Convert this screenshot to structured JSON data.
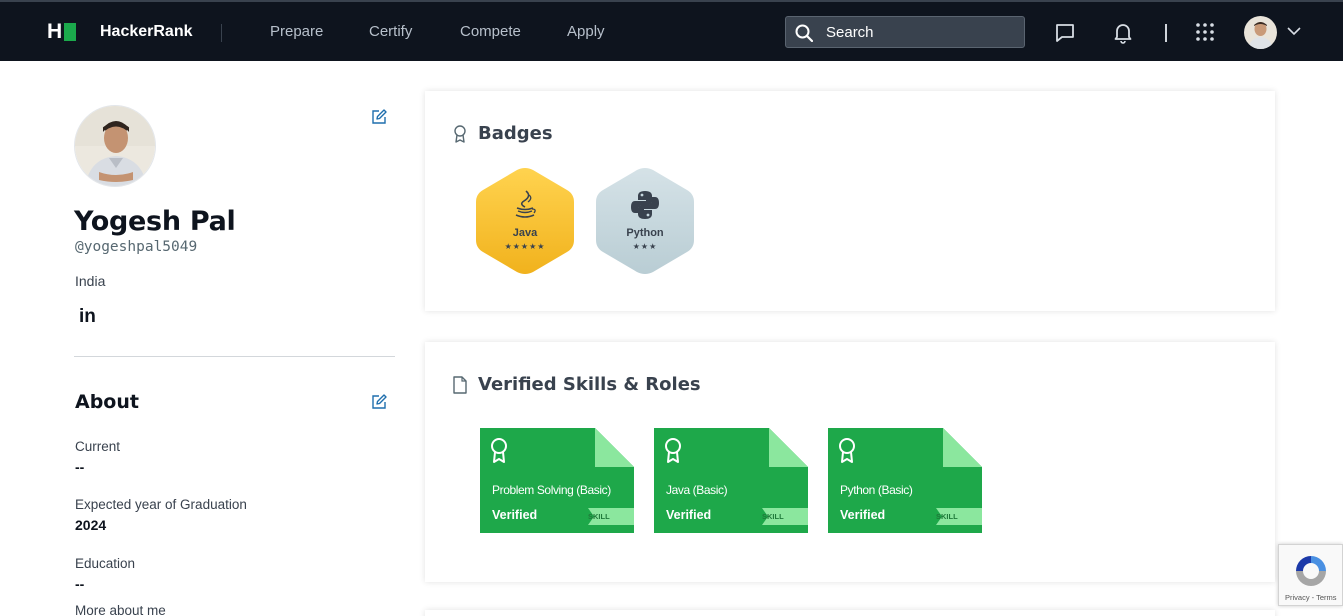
{
  "nav": {
    "brand": "HackerRank",
    "links": [
      "Prepare",
      "Certify",
      "Compete",
      "Apply"
    ],
    "search_label": "Search"
  },
  "profile": {
    "name": "Yogesh Pal",
    "handle": "@yogeshpal5049",
    "country": "India",
    "social": "in"
  },
  "about": {
    "title": "About",
    "fields": [
      {
        "label": "Current",
        "value": "--"
      },
      {
        "label": "Expected year of Graduation",
        "value": "2024"
      },
      {
        "label": "Education",
        "value": "--"
      },
      {
        "label": "More about me",
        "value": ""
      }
    ]
  },
  "badges": {
    "title": "Badges",
    "items": [
      {
        "name": "Java",
        "stars": "★★★★★",
        "color": "#f7c233",
        "icon": "java-icon"
      },
      {
        "name": "Python",
        "stars": "★★★",
        "color": "#c6d7de",
        "icon": "python-icon"
      }
    ]
  },
  "skills": {
    "title": "Verified Skills & Roles",
    "items": [
      {
        "name": "Problem Solving (Basic)",
        "status": "Verified",
        "tag": "SKILL"
      },
      {
        "name": "Java (Basic)",
        "status": "Verified",
        "tag": "SKILL"
      },
      {
        "name": "Python (Basic)",
        "status": "Verified",
        "tag": "SKILL"
      }
    ]
  },
  "recaptcha": {
    "text": "Privacy - Terms"
  },
  "colors": {
    "nav_bg": "#0e141e",
    "brand_green": "#1ba94c",
    "cert_green": "#1ea84a",
    "edit_blue": "#1f6fad"
  }
}
